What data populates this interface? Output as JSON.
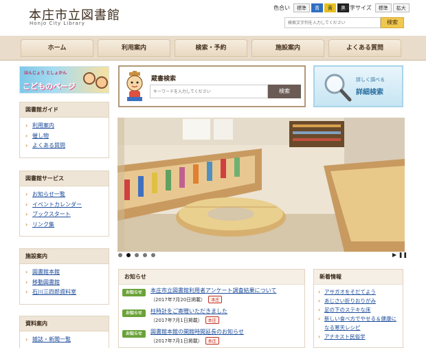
{
  "header": {
    "title": "本庄市立図書館",
    "subtitle": "Honjo City Library",
    "color_label": "色合い",
    "color_options": [
      "標準",
      "青",
      "黄",
      "黒"
    ],
    "size_label": "文字サイズ",
    "size_options": [
      "標準",
      "拡大"
    ],
    "search_placeholder": "検索文字列を入力してください",
    "search_button": "検索"
  },
  "nav": [
    "ホーム",
    "利用案内",
    "検索・予約",
    "施設案内",
    "よくある質問"
  ],
  "kids_banner": {
    "line1": "ほんじょう としょかん",
    "line2": "こどものページ"
  },
  "sidebar": {
    "guide": {
      "title": "図書館ガイド",
      "items": [
        "利用案内",
        "催し物",
        "よくある質問"
      ]
    },
    "service": {
      "title": "図書館サービス",
      "items": [
        "お知らせ一覧",
        "イベントカレンダー",
        "ブックスタート",
        "リンク集"
      ]
    },
    "facility": {
      "title": "施設案内",
      "items": [
        "図書館本館",
        "移動図書館",
        "石川三四郎資料室"
      ]
    },
    "materials": {
      "title": "資料案内",
      "items": [
        "雑誌・新聞一覧"
      ]
    }
  },
  "zousho": {
    "label": "蔵書検索",
    "placeholder": "キーワードを入力してください",
    "button": "検索"
  },
  "detail_banner": {
    "line1": "詳しく調べる",
    "line2": "詳細検索"
  },
  "slideshow": {
    "dot_count": 5,
    "active_index": 1,
    "controls": "▶ ❚❚"
  },
  "news": {
    "title": "お知らせ",
    "items": [
      {
        "tag": "お知らせ",
        "title": "本庄市立図書館利用者アンケート調査結果について",
        "date": "（2017年7月20日掲載）",
        "badge": "本庄"
      },
      {
        "tag": "お知らせ",
        "title": "柱時計をご寄贈いただきました",
        "date": "（2017年7月1日掲載）",
        "badge": "本庄"
      },
      {
        "tag": "お知らせ",
        "title": "図書館本館の開館時間延長のお知らせ",
        "date": "（2017年7月1日掲載）",
        "badge": "本庄"
      }
    ]
  },
  "new_info": {
    "title": "新着情報",
    "items": [
      "アサガオをそだてよう",
      "あじさい折りおりがみ",
      "足の下のステキな床",
      "新しい食べ方でやせる＆健康になる寒天レシピ",
      "アナキスト民俗学"
    ]
  },
  "colors": {
    "nav_bg": "#e9dccb",
    "link": "#1a4a9a",
    "tag_green": "#6aa238",
    "accent_orange": "#c98a3a"
  }
}
